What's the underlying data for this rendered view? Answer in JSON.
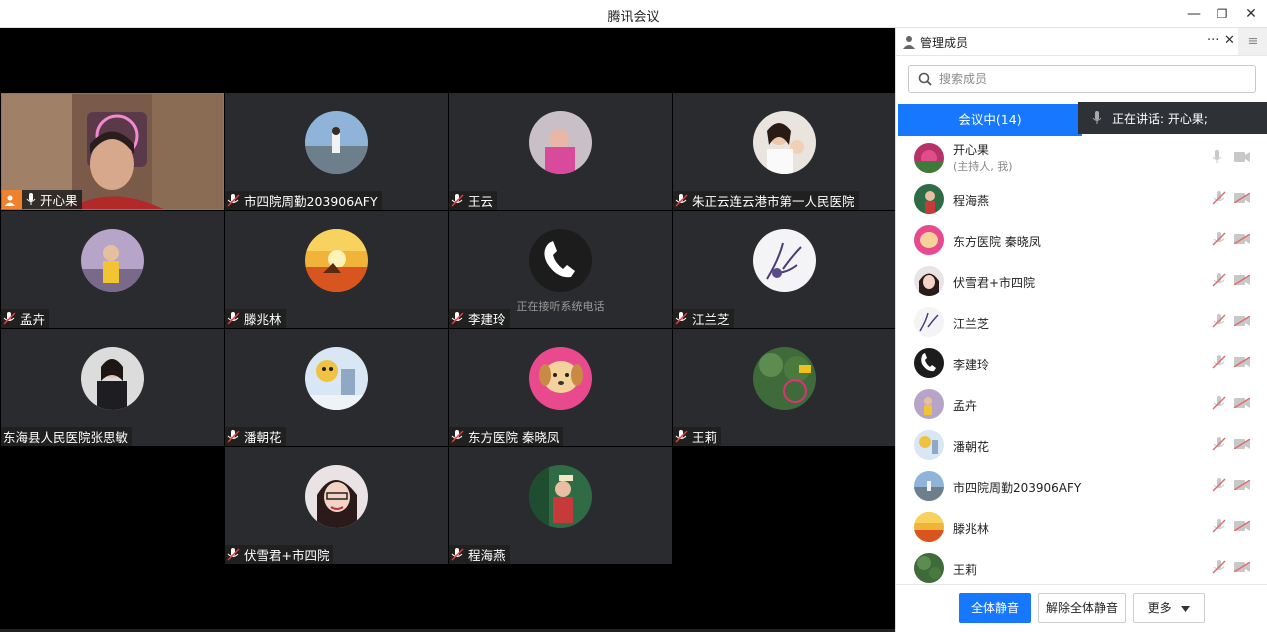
{
  "window": {
    "title": "腾讯会议",
    "minimize": "—",
    "restore": "❐",
    "close": "✕"
  },
  "tiles": [
    {
      "name": "开心果",
      "host": true
    },
    {
      "name": "市四院周勤203906AFY"
    },
    {
      "name": "王云"
    },
    {
      "name": "朱正云连云港市第一人民医院"
    },
    {
      "name": "孟卉"
    },
    {
      "name": "滕兆林"
    },
    {
      "name": "李建玲",
      "status": "正在接听系统电话"
    },
    {
      "name": "江兰芝"
    },
    {
      "name": "东海县人民医院张思敏"
    },
    {
      "name": "潘朝花"
    },
    {
      "name": "东方医院 秦晓凤"
    },
    {
      "name": "王莉"
    },
    {
      "name": "伏雪君+市四院"
    },
    {
      "name": "程海燕"
    }
  ],
  "panel": {
    "title": "管理成员",
    "more": "···",
    "close": "✕",
    "menu": "≡",
    "search_placeholder": "搜索成员",
    "tab_label": "会议中(14)",
    "speaking": "正在讲话: 开心果;",
    "members": [
      {
        "name": "开心果",
        "sub": "(主持人, 我)",
        "muted": false
      },
      {
        "name": "程海燕",
        "muted": true
      },
      {
        "name": "东方医院 秦晓凤",
        "muted": true
      },
      {
        "name": "伏雪君+市四院",
        "muted": true
      },
      {
        "name": "江兰芝",
        "muted": true
      },
      {
        "name": "李建玲",
        "muted": true
      },
      {
        "name": "孟卉",
        "muted": true
      },
      {
        "name": "潘朝花",
        "muted": true
      },
      {
        "name": "市四院周勤203906AFY",
        "muted": true
      },
      {
        "name": "滕兆林",
        "muted": true
      },
      {
        "name": "王莉",
        "muted": true
      }
    ],
    "footer": {
      "mute_all": "全体静音",
      "unmute_all": "解除全体静音",
      "more": "更多"
    }
  },
  "colors": {
    "accent": "#1677ff",
    "host_badge": "#f0822e",
    "tile_bg": "#2a2b2e",
    "active_border": "#1cb25a"
  }
}
